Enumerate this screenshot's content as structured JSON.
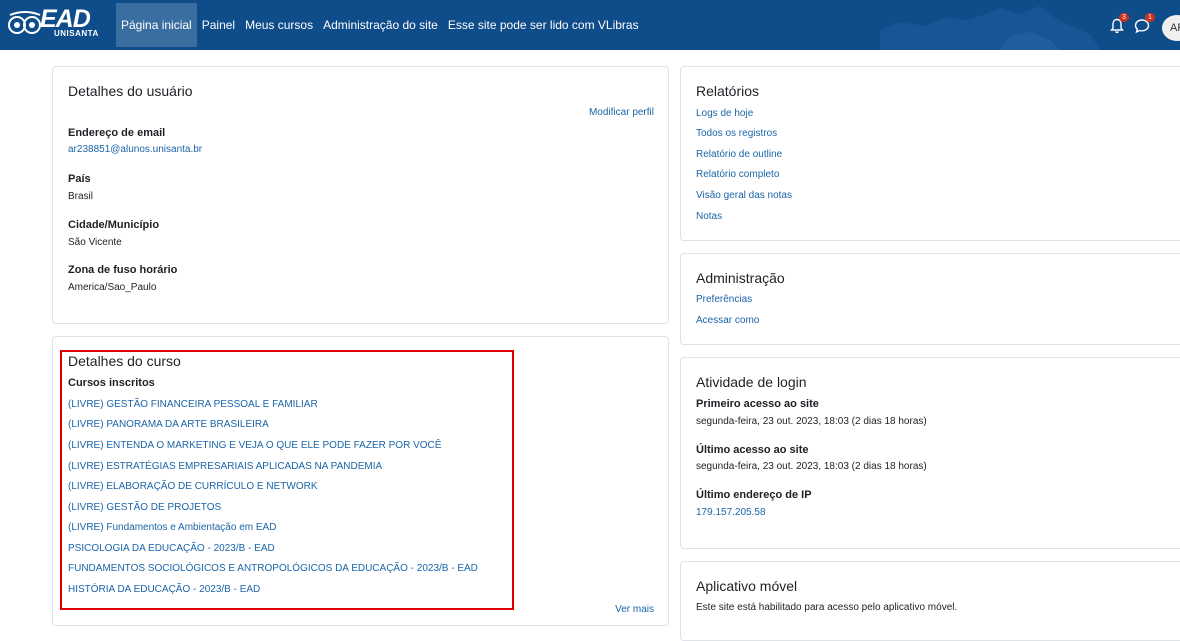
{
  "navbar": {
    "logo_text": "EAD",
    "logo_subtext": "UNISANTA",
    "links": [
      {
        "label": "Página inicial",
        "active": true
      },
      {
        "label": "Painel"
      },
      {
        "label": "Meus cursos"
      },
      {
        "label": "Administração do site"
      },
      {
        "label": "Esse site pode ser lido com VLibras"
      }
    ],
    "notifications_count": "3",
    "messages_count": "1",
    "avatar_initials": "AR"
  },
  "user_details": {
    "title": "Detalhes do usuário",
    "edit_link": "Modificar perfil",
    "fields": [
      {
        "label": "Endereço de email",
        "value": "ar238851@alunos.unisanta.br",
        "is_link": true
      },
      {
        "label": "País",
        "value": "Brasil"
      },
      {
        "label": "Cidade/Município",
        "value": "São Vicente"
      },
      {
        "label": "Zona de fuso horário",
        "value": "America/Sao_Paulo"
      }
    ]
  },
  "course_details": {
    "title": "Detalhes do curso",
    "enrolled_label": "Cursos inscritos",
    "courses": [
      "(LIVRE) GESTÃO FINANCEIRA PESSOAL E FAMILIAR",
      "(LIVRE) PANORAMA DA ARTE BRASILEIRA",
      "(LIVRE) ENTENDA O MARKETING E VEJA O QUE ELE PODE FAZER POR VOCÊ",
      "(LIVRE) ESTRATÉGIAS EMPRESARIAIS APLICADAS NA PANDEMIA",
      "(LIVRE) ELABORAÇÃO DE CURRÍCULO E NETWORK",
      "(LIVRE) GESTÃO DE PROJETOS",
      "(LIVRE) Fundamentos e Ambientação em EAD",
      "PSICOLOGIA DA EDUCAÇÃO - 2023/B - EAD",
      "FUNDAMENTOS SOCIOLÓGICOS E ANTROPOLÓGICOS DA EDUCAÇÃO - 2023/B - EAD",
      "HISTÓRIA DA EDUCAÇÃO - 2023/B - EAD"
    ],
    "more_link": "Ver mais"
  },
  "reports": {
    "title": "Relatórios",
    "links": [
      "Logs de hoje",
      "Todos os registros",
      "Relatório de outline",
      "Relatório completo",
      "Visão geral das notas",
      "Notas"
    ]
  },
  "administration": {
    "title": "Administração",
    "links": [
      "Preferências",
      "Acessar como"
    ]
  },
  "login_activity": {
    "title": "Atividade de login",
    "first_access_label": "Primeiro acesso ao site",
    "first_access_value": "segunda-feira, 23 out. 2023, 18:03  (2 dias 18 horas)",
    "last_access_label": "Último acesso ao site",
    "last_access_value": "segunda-feira, 23 out. 2023, 18:03  (2 dias 18 horas)",
    "last_ip_label": "Último endereço de IP",
    "last_ip_value": "179.157.205.58"
  },
  "mobile_app": {
    "title": "Aplicativo móvel",
    "text": "Este site está habilitado para acesso pelo aplicativo móvel."
  },
  "colors": {
    "navbar_bg": "#0f4c8a",
    "link": "#1a65a8",
    "highlight_border": "#e00000"
  }
}
